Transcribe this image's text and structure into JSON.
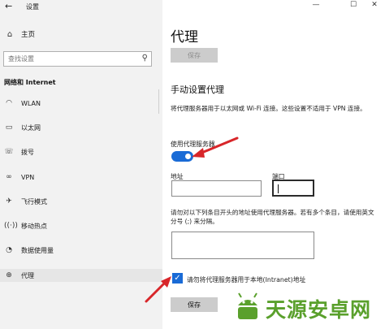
{
  "window": {
    "back_icon": "back-arrow-icon",
    "title": "设置",
    "controls": {
      "minimize": "—",
      "maximize": "☐",
      "close": "✕"
    }
  },
  "sidebar": {
    "home": {
      "icon": "home-icon",
      "label": "主页"
    },
    "search": {
      "placeholder": "查找设置",
      "icon": "search-icon"
    },
    "section": "网络和 Internet",
    "items": [
      {
        "icon": "wifi-icon",
        "label": "WLAN"
      },
      {
        "icon": "ethernet-icon",
        "label": "以太网"
      },
      {
        "icon": "dialup-icon",
        "label": "拨号"
      },
      {
        "icon": "vpn-icon",
        "label": "VPN"
      },
      {
        "icon": "airplane-icon",
        "label": "飞行模式"
      },
      {
        "icon": "hotspot-icon",
        "label": "移动热点"
      },
      {
        "icon": "data-usage-icon",
        "label": "数据使用量"
      },
      {
        "icon": "globe-icon",
        "label": "代理"
      }
    ],
    "selected_index": 7
  },
  "main": {
    "title": "代理",
    "save_top": "保存",
    "manual_heading": "手动设置代理",
    "manual_desc": "将代理服务器用于以太网或 Wi-Fi 连接。这些设置不适用于 VPN 连接。",
    "use_proxy_label": "使用代理服务器",
    "use_proxy_on": true,
    "address_label": "地址",
    "address_value": "",
    "port_label": "端口",
    "port_value": "",
    "exceptions_desc": "请勿对以下列条目开头的地址使用代理服务器。若有多个条目，请使用英文分号 (;) 来分隔。",
    "exceptions_value": "",
    "local_checkbox_label": "请勿将代理服务器用于本地(Intranet)地址",
    "local_checkbox_checked": true,
    "save_bottom": "保存"
  },
  "watermark": {
    "text": "天源安卓网"
  },
  "colors": {
    "accent": "#1a6bd6",
    "arrow": "#d8262a",
    "watermark": "#5aa02c"
  }
}
